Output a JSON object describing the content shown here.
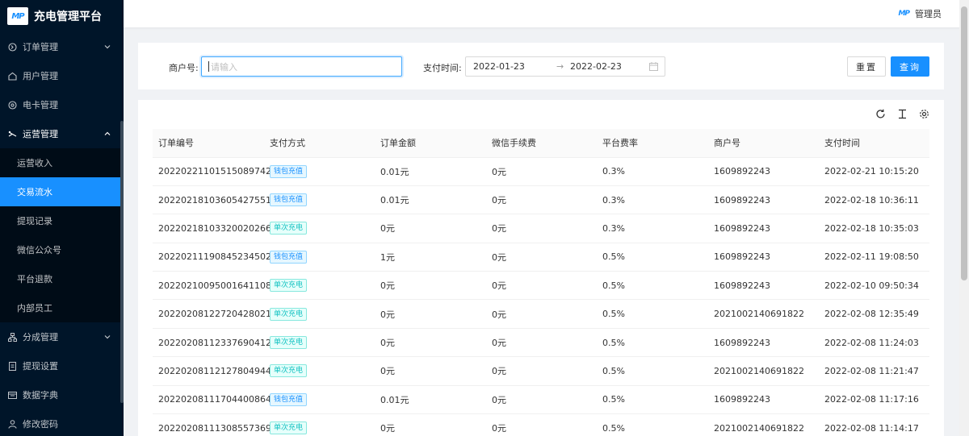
{
  "app": {
    "title": "充电管理平台",
    "logo_text": "MP"
  },
  "sidebar": {
    "items": [
      {
        "label": "订单管理",
        "icon": "order-icon",
        "expandable": true
      },
      {
        "label": "用户管理",
        "icon": "user-icon",
        "expandable": false
      },
      {
        "label": "电卡管理",
        "icon": "card-icon",
        "expandable": false
      },
      {
        "label": "运营管理",
        "icon": "operation-icon",
        "expandable": true,
        "open": true
      }
    ],
    "sub_items": [
      {
        "label": "运营收入"
      },
      {
        "label": "交易流水",
        "active": true
      },
      {
        "label": "提现记录"
      },
      {
        "label": "微信公众号"
      },
      {
        "label": "平台退款"
      },
      {
        "label": "内部员工"
      }
    ],
    "items_after": [
      {
        "label": "分成管理",
        "icon": "split-icon",
        "expandable": true
      },
      {
        "label": "提现设置",
        "icon": "withdraw-icon",
        "expandable": false
      },
      {
        "label": "数据字典",
        "icon": "dictionary-icon",
        "expandable": false
      },
      {
        "label": "修改密码",
        "icon": "lock-icon",
        "expandable": false
      }
    ]
  },
  "header": {
    "admin_mark": "MP",
    "admin_name": "管理员"
  },
  "search": {
    "merchant_label": "商户号:",
    "merchant_placeholder": "请输入",
    "merchant_value": "",
    "paytime_label": "支付时间:",
    "date_start": "2022-01-23",
    "date_separator": "→",
    "date_end": "2022-02-23",
    "reset_label": "重置",
    "query_label": "查询"
  },
  "table": {
    "columns": [
      "订单编号",
      "支付方式",
      "订单金额",
      "微信手续费",
      "平台费率",
      "商户号",
      "支付时间"
    ],
    "rows": [
      {
        "order_no": "20220221101515089742",
        "pay_method": "钱包充值",
        "pay_type": "wallet",
        "amount": "0.01元",
        "wx_fee": "0元",
        "rate": "0.3%",
        "merchant": "1609892243",
        "time": "2022-02-21 10:15:20"
      },
      {
        "order_no": "20220218103605427551",
        "pay_method": "钱包充值",
        "pay_type": "wallet",
        "amount": "0.01元",
        "wx_fee": "0元",
        "rate": "0.3%",
        "merchant": "1609892243",
        "time": "2022-02-18 10:36:11"
      },
      {
        "order_no": "20220218103320020266",
        "pay_method": "单次充电",
        "pay_type": "single",
        "amount": "0元",
        "wx_fee": "0元",
        "rate": "0.3%",
        "merchant": "1609892243",
        "time": "2022-02-18 10:35:03"
      },
      {
        "order_no": "20220211190845234502",
        "pay_method": "钱包充值",
        "pay_type": "wallet",
        "amount": "1元",
        "wx_fee": "0元",
        "rate": "0.5%",
        "merchant": "1609892243",
        "time": "2022-02-11 19:08:50"
      },
      {
        "order_no": "20220210095001641108",
        "pay_method": "单次充电",
        "pay_type": "single",
        "amount": "0元",
        "wx_fee": "0元",
        "rate": "0.5%",
        "merchant": "1609892243",
        "time": "2022-02-10 09:50:34"
      },
      {
        "order_no": "20220208122720428021",
        "pay_method": "单次充电",
        "pay_type": "single",
        "amount": "0元",
        "wx_fee": "0元",
        "rate": "0.5%",
        "merchant": "2021002140691822",
        "time": "2022-02-08 12:35:49"
      },
      {
        "order_no": "20220208112337690412",
        "pay_method": "单次充电",
        "pay_type": "single",
        "amount": "0元",
        "wx_fee": "0元",
        "rate": "0.5%",
        "merchant": "1609892243",
        "time": "2022-02-08 11:24:03"
      },
      {
        "order_no": "20220208112127804944",
        "pay_method": "单次充电",
        "pay_type": "single",
        "amount": "0元",
        "wx_fee": "0元",
        "rate": "0.5%",
        "merchant": "2021002140691822",
        "time": "2022-02-08 11:21:47"
      },
      {
        "order_no": "20220208111704400864",
        "pay_method": "钱包充值",
        "pay_type": "wallet",
        "amount": "0.01元",
        "wx_fee": "0元",
        "rate": "0.5%",
        "merchant": "1609892243",
        "time": "2022-02-08 11:17:16"
      },
      {
        "order_no": "20220208111308557369",
        "pay_method": "单次充电",
        "pay_type": "single",
        "amount": "0元",
        "wx_fee": "0元",
        "rate": "0.5%",
        "merchant": "2021002140691822",
        "time": "2022-02-08 11:14:17"
      }
    ]
  },
  "toolbar": {
    "icons": [
      "refresh-icon",
      "column-height-icon",
      "settings-icon"
    ]
  },
  "colors": {
    "primary": "#1890ff",
    "sidebar_bg": "#001529",
    "submenu_bg": "#000c17",
    "tag_blue": "#1890ff",
    "tag_cyan": "#13c2c2"
  }
}
